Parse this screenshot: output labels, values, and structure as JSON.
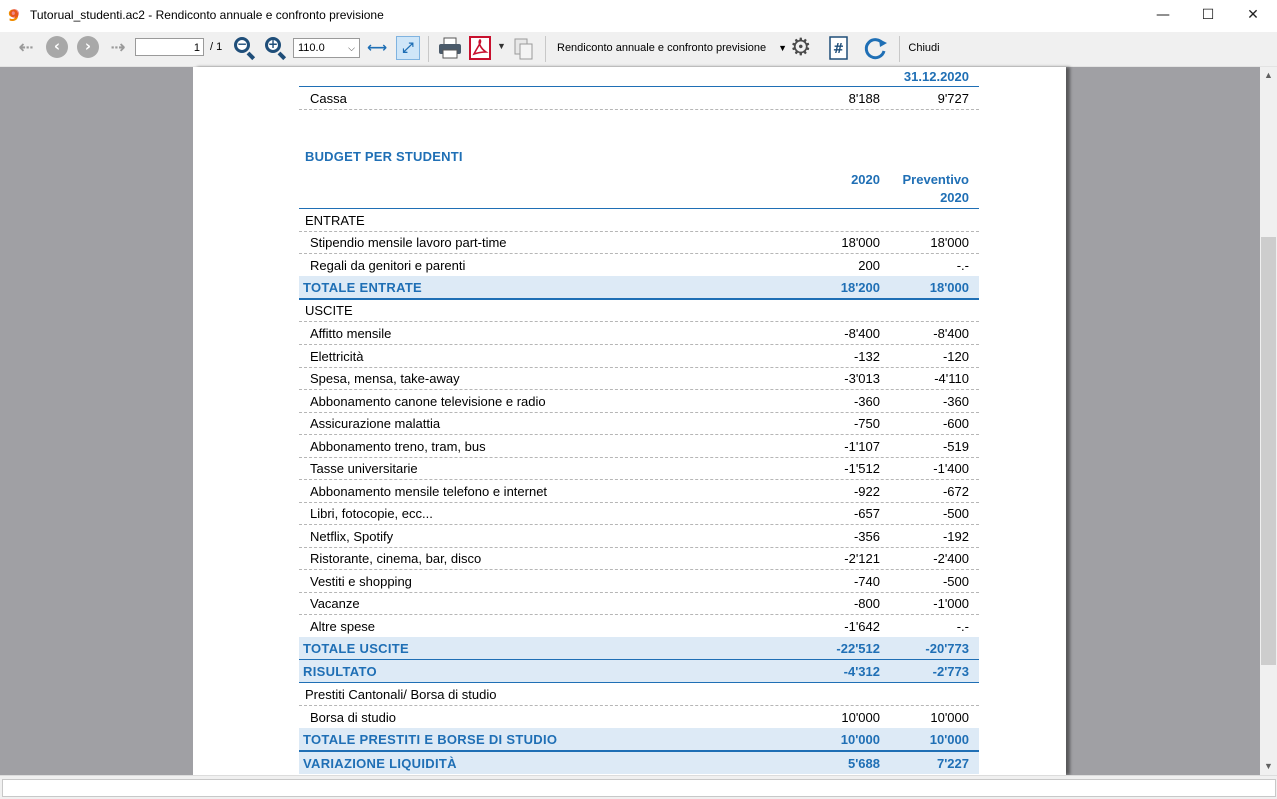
{
  "window": {
    "title": "Tutorual_studenti.ac2 - Rendiconto annuale e confronto previsione",
    "app_icon": "banana-9-icon",
    "minimize": "—",
    "maximize": "☐",
    "close": "✕"
  },
  "toolbar": {
    "page_current": "1",
    "page_total": "/ 1",
    "zoom_value": "110.0",
    "report_name": "Rendiconto annuale e confronto previsione",
    "close_label": "Chiudi",
    "icons": [
      "back-arrow-icon",
      "previous-page-icon",
      "next-page-icon",
      "forward-arrow-icon",
      "zoom-out-icon",
      "zoom-in-icon",
      "fit-width-icon",
      "fit-page-icon",
      "print-icon",
      "pdf-icon",
      "copy-icon",
      "settings-icon",
      "page-number-icon",
      "refresh-icon"
    ]
  },
  "report": {
    "top_section": {
      "date_header": "31.12.2020",
      "rows": [
        {
          "label": "Cassa",
          "v1": "8'188",
          "v2": "9'727"
        }
      ]
    },
    "budget_title": "BUDGET PER STUDENTI",
    "col1_header": "2020",
    "col2_header_line1": "Preventivo",
    "col2_header_line2": "2020",
    "entrate_header": "ENTRATE",
    "entrate": [
      {
        "label": "Stipendio mensile lavoro part-time",
        "v1": "18'000",
        "v2": "18'000"
      },
      {
        "label": "Regali da genitori e parenti",
        "v1": "200",
        "v2": "-.-"
      }
    ],
    "totale_entrate": {
      "label": "TOTALE ENTRATE",
      "v1": "18'200",
      "v2": "18'000"
    },
    "uscite_header": "USCITE",
    "uscite": [
      {
        "label": "Affitto mensile",
        "v1": "-8'400",
        "v2": "-8'400"
      },
      {
        "label": "Elettricità",
        "v1": "-132",
        "v2": "-120"
      },
      {
        "label": "Spesa, mensa, take-away",
        "v1": "-3'013",
        "v2": "-4'110"
      },
      {
        "label": "Abbonamento canone televisione e radio",
        "v1": "-360",
        "v2": "-360"
      },
      {
        "label": "Assicurazione malattia",
        "v1": "-750",
        "v2": "-600"
      },
      {
        "label": "Abbonamento treno, tram, bus",
        "v1": "-1'107",
        "v2": "-519"
      },
      {
        "label": "Tasse universitarie",
        "v1": "-1'512",
        "v2": "-1'400"
      },
      {
        "label": "Abbonamento mensile telefono e internet",
        "v1": "-922",
        "v2": "-672"
      },
      {
        "label": "Libri, fotocopie, ecc...",
        "v1": "-657",
        "v2": "-500"
      },
      {
        "label": "Netflix, Spotify",
        "v1": "-356",
        "v2": "-192"
      },
      {
        "label": "Ristorante, cinema, bar, disco",
        "v1": "-2'121",
        "v2": "-2'400"
      },
      {
        "label": "Vestiti e shopping",
        "v1": "-740",
        "v2": "-500"
      },
      {
        "label": "Vacanze",
        "v1": "-800",
        "v2": "-1'000"
      },
      {
        "label": "Altre spese",
        "v1": "-1'642",
        "v2": "-.-"
      }
    ],
    "totale_uscite": {
      "label": "TOTALE USCITE",
      "v1": "-22'512",
      "v2": "-20'773"
    },
    "risultato": {
      "label": "RISULTATO",
      "v1": "-4'312",
      "v2": "-2'773"
    },
    "prestiti_header": "Prestiti Cantonali/ Borsa di studio",
    "prestiti": [
      {
        "label": "Borsa di studio",
        "v1": "10'000",
        "v2": "10'000"
      }
    ],
    "totale_prestiti": {
      "label": "TOTALE PRESTITI E BORSE DI STUDIO",
      "v1": "10'000",
      "v2": "10'000"
    },
    "variazione": {
      "label": "VARIAZIONE LIQUIDITÀ",
      "v1": "5'688",
      "v2": "7'227"
    }
  },
  "colors": {
    "accent": "#1f6fb5",
    "total_bg": "#ddeaf6",
    "viewer_bg": "#a0a0a4"
  }
}
